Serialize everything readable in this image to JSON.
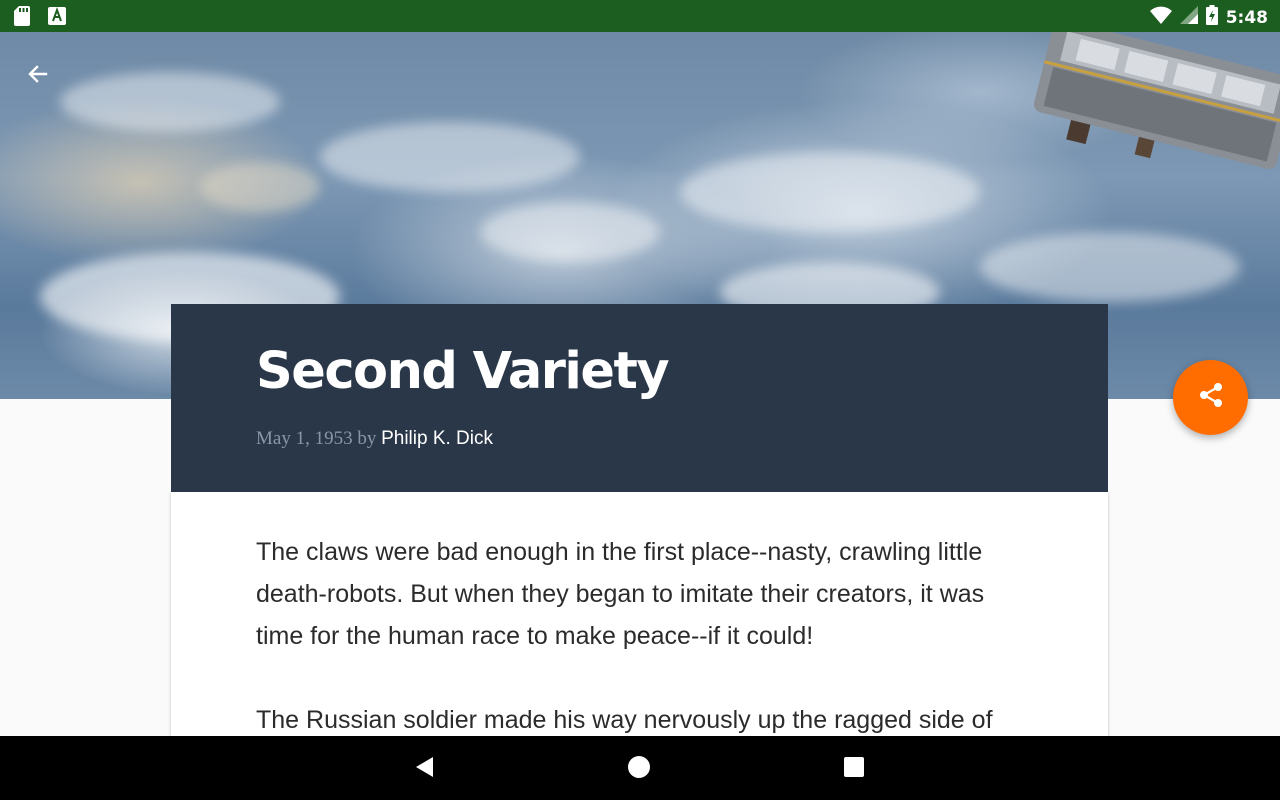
{
  "status_bar": {
    "time": "5:48",
    "left_icons": [
      "sd-card-icon",
      "font-app-icon"
    ],
    "right_icons": [
      "wifi-icon",
      "signal-icon",
      "battery-icon"
    ],
    "background": "#1b5e20"
  },
  "header": {
    "back_icon": "arrow-back-icon"
  },
  "article": {
    "title": "Second Variety",
    "date": "May 1, 1953",
    "by": "by",
    "author": "Philip K. Dick",
    "header_background": "#2a3749",
    "paragraphs": [
      "The claws were bad enough in the first place--nasty, crawling little death-robots. But when they began to imitate their creators, it was time for the human race to make peace--if it could!",
      "The Russian soldier made his way nervously up the ragged side of"
    ]
  },
  "fab": {
    "icon": "share-icon",
    "color": "#ff6d00"
  },
  "nav_bar": {
    "buttons": [
      "nav-back-icon",
      "nav-home-icon",
      "nav-recents-icon"
    ]
  }
}
